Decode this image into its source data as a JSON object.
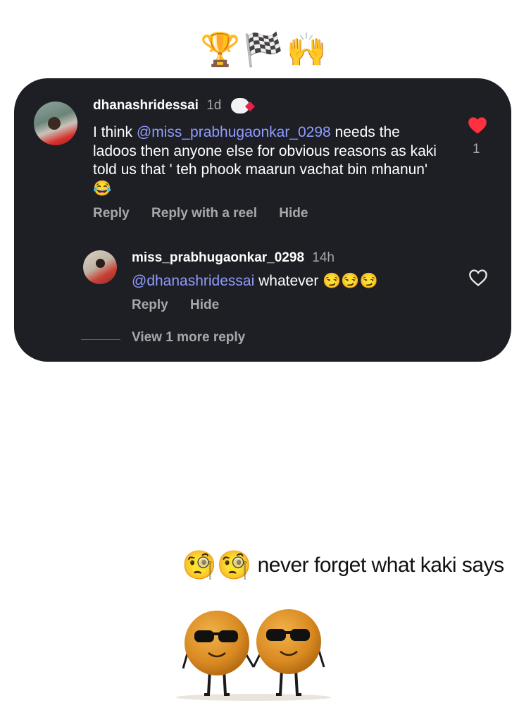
{
  "top_emojis": "🏆🏁🙌",
  "comment": {
    "username": "dhanashridessai",
    "time": "1d",
    "text_before": "I think ",
    "mention": "@miss_prabhugaonkar_0298",
    "text_after": " needs the ladoos then anyone else for obvious reasons as kaki told us that ' teh phook maarun vachat bin mhanun' 😂",
    "actions": [
      "Reply",
      "Reply with a reel",
      "Hide"
    ],
    "like_count": "1",
    "liked": true
  },
  "reply": {
    "username": "miss_prabhugaonkar_0298",
    "time": "14h",
    "mention": "@dhanashridessai",
    "text": " whatever 😏😏😏",
    "actions": [
      "Reply",
      "Hide"
    ],
    "liked": false
  },
  "view_more": "View 1 more reply",
  "caption": {
    "emojis": "🧐🧐",
    "text": "never forget what kaki says"
  },
  "colors": {
    "card_bg": "#1e1f24",
    "mention": "#8f9cff",
    "like_red": "#ff3040",
    "muted": "#a8a8ac"
  }
}
